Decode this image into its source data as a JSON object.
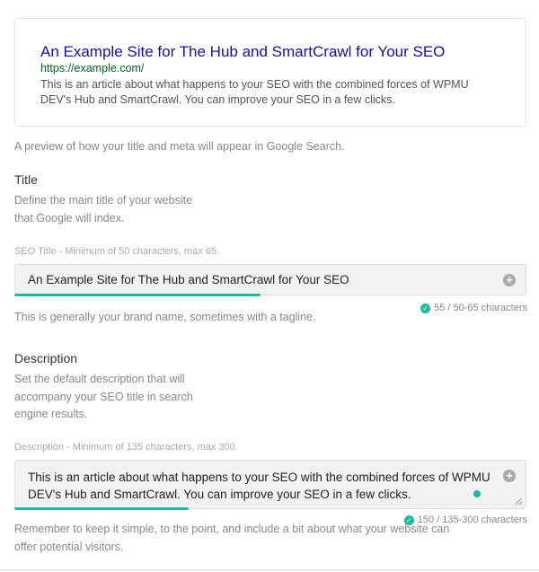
{
  "preview": {
    "title": "An Example Site for The Hub and SmartCrawl for Your SEO",
    "url": "https://example.com/",
    "description": "This is an article about what happens to your SEO with the combined forces of WPMU DEV's Hub and SmartCrawl. You can improve your SEO in a few clicks."
  },
  "preview_caption": "A preview of how your title and meta will appear in Google Search.",
  "title_section": {
    "heading": "Title",
    "description_line1": "Define the main title of your website",
    "description_line2": "that Google will index.",
    "field_label": "SEO Title",
    "field_hint": " - Minimum of 50 characters, max 65.",
    "value": "An Example Site for The Hub and SmartCrawl for Your SEO",
    "counter": "55 / 50-65 characters",
    "progress": 0.48,
    "help_text": "This is generally your brand name, sometimes with a tagline."
  },
  "description_section": {
    "heading": "Description",
    "description_line1": "Set the default description that will",
    "description_line2": "accompany your SEO title in search",
    "description_line3": "engine results.",
    "field_label": "Description",
    "field_hint": " - Minimum of 135 characters, max 300.",
    "value_line1": "This is an article about what happens to your SEO with the combined forces of WPMU",
    "value_line2": "DEV's Hub and SmartCrawl. You can improve your SEO in a few clicks.",
    "counter": "150 / 135-300 characters",
    "progress": 0.34,
    "help_line1": "Remember to keep it simple, to the point, and include a bit about what your website can",
    "help_line2": "offer potential visitors."
  },
  "colors": {
    "accent": "#1abc9c",
    "link_blue": "#1a0dab",
    "url_green": "#006621"
  },
  "icons": {
    "plus": "+",
    "check": "✓"
  }
}
